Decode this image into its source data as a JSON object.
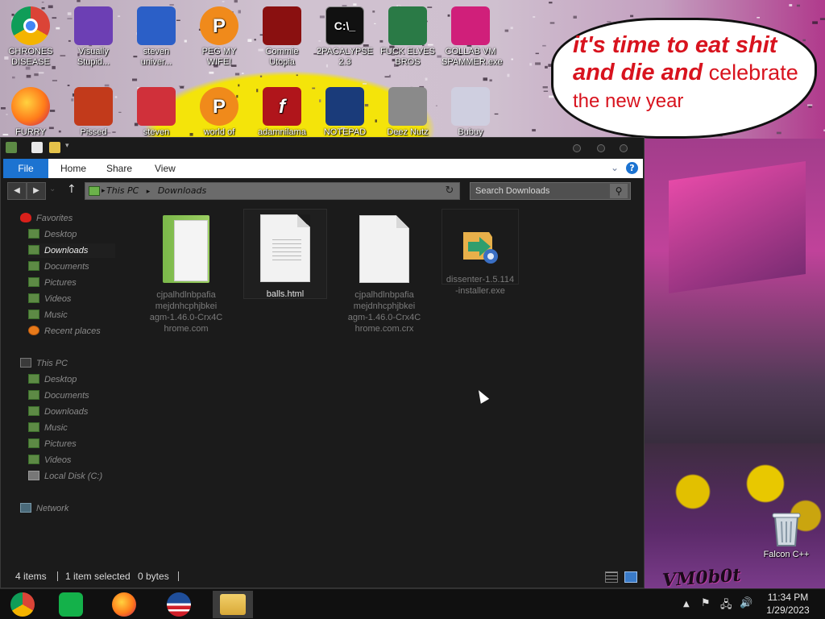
{
  "desktop": {
    "icons": [
      {
        "label": "CHRONES DISEASE",
        "icon": "chrome-icon",
        "color": "#e53935"
      },
      {
        "label": "Visually Stupid...",
        "icon": "visual-studio-icon",
        "color": "#6c3fb4"
      },
      {
        "label": "steven univer...",
        "icon": "steven-universe-icon",
        "color": "#2b5fc7"
      },
      {
        "label": "PEG MY WIFE!",
        "icon": "peggle-icon",
        "color": "#f08a1b"
      },
      {
        "label": "Commie Utopia",
        "icon": "commie-utopia-icon",
        "color": "#8a1010"
      },
      {
        "label": "2PACALYPSE 2.3",
        "icon": "cmd-icon",
        "color": "#111111"
      },
      {
        "label": "FUCK ELVES BROS",
        "icon": "elf-icon",
        "color": "#2a7a46"
      },
      {
        "label": "COLLAB VM SPAMMER.exe",
        "icon": "spammer-icon",
        "color": "#d01f7a"
      },
      {
        "label": "FURRY CUCKS",
        "icon": "firefox-icon",
        "color": "#ff7b1a"
      },
      {
        "label": "Pissed",
        "icon": "angry-birds-icon",
        "color": "#c23a1b"
      },
      {
        "label": "steven",
        "icon": "diamond-icon",
        "color": "#d0303a"
      },
      {
        "label": "world of",
        "icon": "peggle-icon",
        "color": "#f08a1b"
      },
      {
        "label": "adamnilama",
        "icon": "flash-icon",
        "color": "#b0151b"
      },
      {
        "label": "NOTEPAD",
        "icon": "notepad-icon",
        "color": "#1a3b7a"
      },
      {
        "label": "Deez Nutz",
        "icon": "stack-icon",
        "color": "#8a8a8a"
      },
      {
        "label": "Bubuy",
        "icon": "install-icon",
        "color": "#cfcfe0"
      }
    ],
    "bubble": {
      "line1": "it's time to eat shit",
      "line2a": "and die and",
      "line2b": " celebrate",
      "line3": "the new year"
    },
    "recycle_bin_label": "Falcon C++",
    "corner_tag": "VM0b0t"
  },
  "explorer": {
    "ribbon_tabs": [
      "File",
      "Home",
      "Share",
      "View"
    ],
    "address": [
      "This PC",
      "Downloads"
    ],
    "search_placeholder": "Search Downloads",
    "nav": {
      "favorites_header": "Favorites",
      "favorites": [
        "Desktop",
        "Downloads",
        "Documents",
        "Pictures",
        "Videos",
        "Music",
        "Recent places"
      ],
      "thispc_header": "This PC",
      "thispc": [
        "Desktop",
        "Documents",
        "Downloads",
        "Music",
        "Pictures",
        "Videos",
        "Local Disk (C:)"
      ],
      "network": "Network",
      "selected": "Downloads"
    },
    "files": [
      {
        "name": "cjpalhdlnbpafiamejdnhcphjbkeiagm-1.46.0-Crx4Chrome.com",
        "lines": [
          "cjpalhdlnbpafia",
          "mejdnhcphjbkei",
          "agm-1.46.0-Crx4C",
          "hrome.com"
        ],
        "type": "zip-folder",
        "selected": false
      },
      {
        "name": "balls.html",
        "lines": [
          "balls.html"
        ],
        "type": "html-document",
        "selected": true
      },
      {
        "name": "cjpalhdlnbpafiamejdnhcphjbkeiagm-1.46.0-Crx4Chrome.com.crx",
        "lines": [
          "cjpalhdlnbpafia",
          "mejdnhcphjbkei",
          "agm-1.46.0-Crx4C",
          "hrome.com.crx"
        ],
        "type": "blank-document",
        "selected": false
      },
      {
        "name": "dissenter-1.5.114-installer.exe",
        "lines": [
          "dissenter-1.5.114",
          "-installer.exe"
        ],
        "type": "installer",
        "selected": false
      }
    ],
    "status": {
      "items": "4 items",
      "selected": "1 item selected",
      "size": "0 bytes"
    }
  },
  "taskbar": {
    "apps": [
      {
        "name": "chrome",
        "icon": "chrome-icon"
      },
      {
        "name": "notes",
        "icon": "notes-icon"
      },
      {
        "name": "firefox",
        "icon": "firefox-icon"
      },
      {
        "name": "obama",
        "icon": "obama-logo-icon"
      },
      {
        "name": "file-explorer",
        "icon": "folder-icon",
        "active": true
      }
    ],
    "time": "11:34 PM",
    "date": "1/29/2023"
  }
}
